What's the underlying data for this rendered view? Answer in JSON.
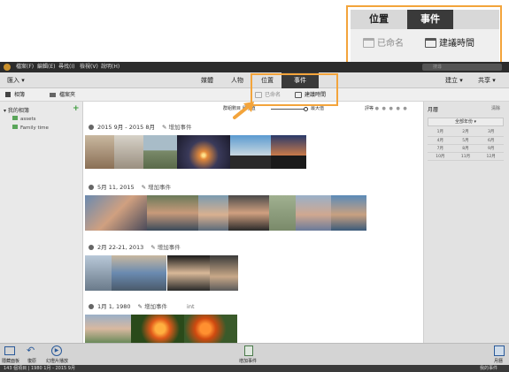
{
  "callout": {
    "tab_location": "位置",
    "tab_events": "事件",
    "named": "已命名",
    "created_time": "建議時間"
  },
  "menubar": {
    "items": [
      "檔案(F)",
      "編輯(E)",
      "尋找(I)",
      "檢視(V)",
      "說明(H)"
    ],
    "search_placeholder": "搜尋"
  },
  "toolbar": {
    "import": "匯入",
    "tabs": [
      "媒體",
      "人物",
      "位置",
      "事件"
    ],
    "create": "建立",
    "share": "共享"
  },
  "subbar": {
    "albums": "相簿",
    "folders": "檔案夾",
    "named": "已命名",
    "created_time": "建議時間",
    "grouping": "群組數目",
    "min": "最小值",
    "max": "最大值",
    "rating": "評等"
  },
  "sidebar": {
    "section": "我的相簿",
    "albums": [
      "assets",
      "Family time"
    ]
  },
  "events": [
    {
      "date": "2015 9月 - 2015 8月",
      "add": "增加事件"
    },
    {
      "date": "5月 11, 2015",
      "add": "增加事件"
    },
    {
      "date": "2月 22-21, 2013",
      "add": "增加事件"
    },
    {
      "date": "1月 1, 1980",
      "add": "增加事件",
      "extra": "int"
    }
  ],
  "calendar": {
    "title": "月曆",
    "clear": "清除",
    "all_years": "全部年份",
    "months": [
      "1月",
      "2月",
      "3月",
      "4月",
      "5月",
      "6月",
      "7月",
      "8月",
      "9月",
      "10月",
      "11月",
      "12月"
    ]
  },
  "statusbar": {
    "hide_panel": "隱藏面板",
    "undo": "復原",
    "slideshow": "幻燈片播放",
    "add_event": "增加事件",
    "calendar": "月曆",
    "info": "143 個項目 | 1980 1月 - 2015 9月",
    "my_events": "我的事件"
  },
  "colors": {
    "accent": "#f3a43b",
    "dark_tab": "#3a3a3a"
  }
}
